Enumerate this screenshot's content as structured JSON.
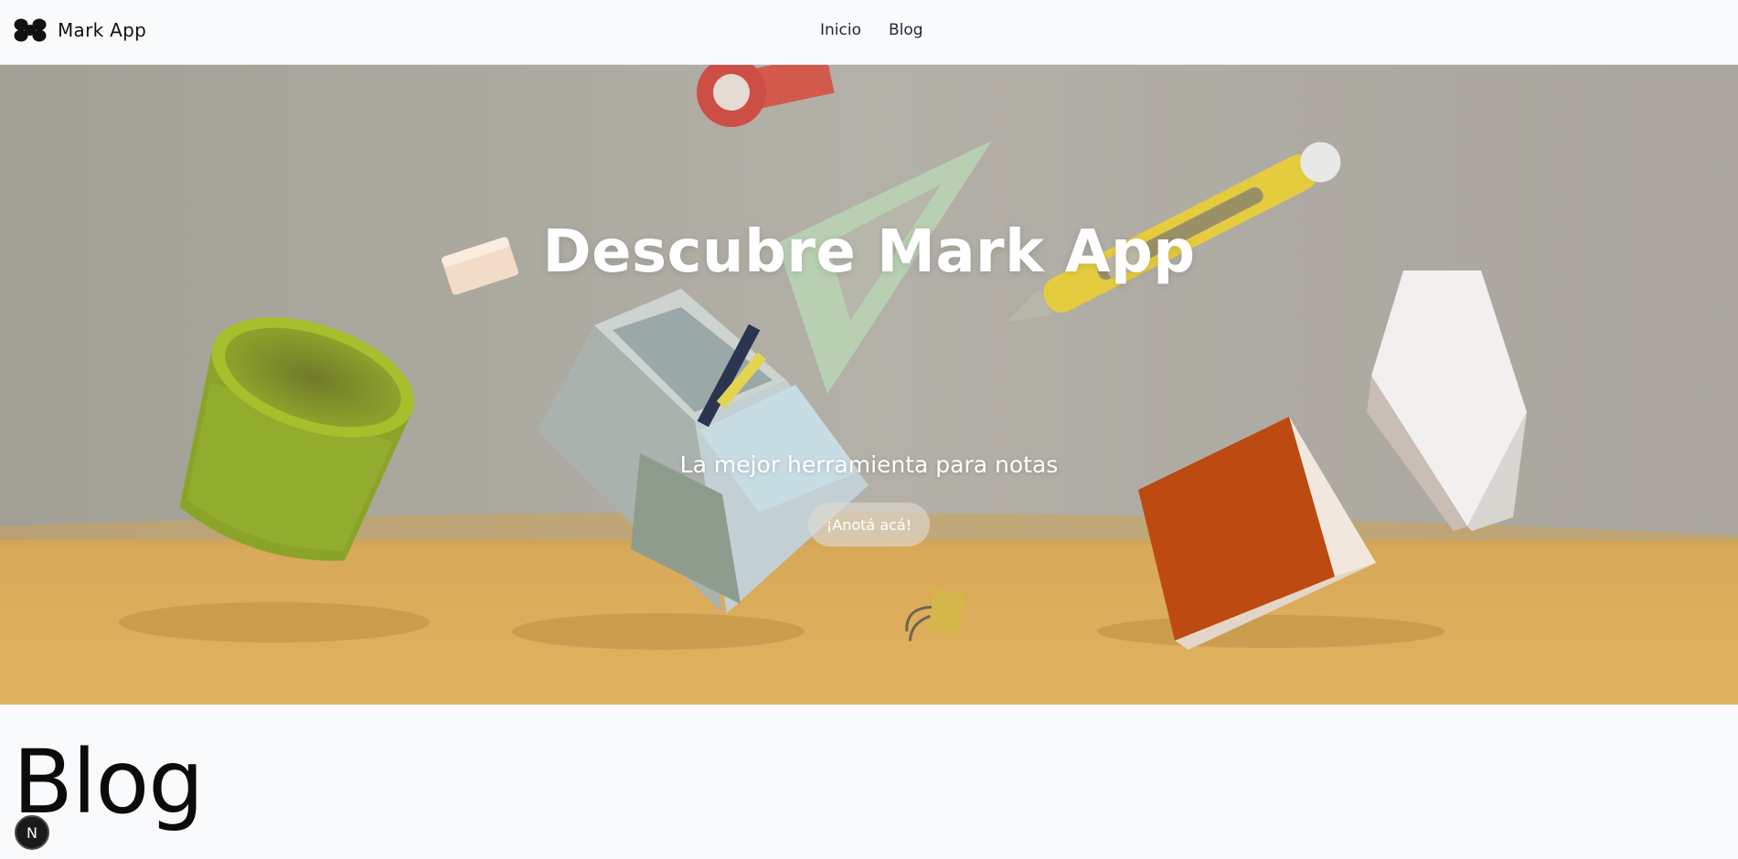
{
  "header": {
    "brand_name": "Mark App",
    "logo_icon": "blob-cluster-logo-icon",
    "nav": [
      "Inicio",
      "Blog"
    ]
  },
  "hero": {
    "title": "Descubre Mark App",
    "subtitle": "La mejor herramienta para notas",
    "cta_label": "¡Anotá acá!",
    "background": "floating-desk-supplies-photo",
    "colors": {
      "wall": "#a8a29a",
      "desk": "#ddb05a",
      "text": "#ffffff"
    }
  },
  "blog": {
    "heading": "Blog"
  },
  "dev_indicator": {
    "label": "N"
  }
}
